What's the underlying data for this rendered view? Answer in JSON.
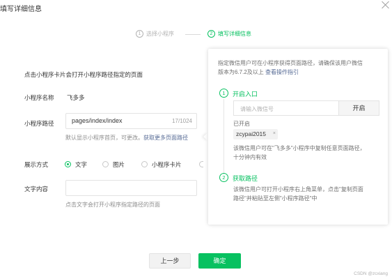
{
  "dialog": {
    "title": "填写详细信息"
  },
  "steps": [
    {
      "num": "1",
      "label": "选择小程序",
      "active": false
    },
    {
      "num": "2",
      "label": "填写详细信息",
      "active": true
    }
  ],
  "form": {
    "intro": "点击小程序卡片会打开小程序路径指定的页面",
    "name_label": "小程序名称",
    "name_value": "飞多多",
    "path_label": "小程序路径",
    "path_value": "pages/index/index",
    "path_counter": "17/1024",
    "path_hint": "默认显示小程序首页，可更改。",
    "path_link": "获取更多页面路径",
    "display_label": "展示方式",
    "display_options": [
      "文字",
      "图片",
      "小程序卡片"
    ],
    "display_selected": "文字",
    "content_label": "文字内容",
    "content_value": "",
    "content_hint": "点击文字会打开小程序指定路径的页面"
  },
  "panel": {
    "intro_line1": "指定微信用户可在小程序获得页面路径，请确保该用户微信",
    "intro_line2": "版本为6.7.2及以上",
    "intro_link": "查看操作指引",
    "step1": {
      "num": "1",
      "title": "开启入口",
      "input_placeholder": "请输入微信号",
      "button": "开启",
      "enabled_label": "已开启",
      "tag": "zcypai2015",
      "tag_close": "×",
      "desc_line1": "该微信用户可在\"飞多多\"小程序中复制任意页面路径，",
      "desc_line2": "十分钟内有效"
    },
    "step2": {
      "num": "2",
      "title": "获取路径",
      "desc_line1": "该微信用户可打开小程序右上角菜单，点击\"复制页面",
      "desc_line2": "路径\"并粘贴至左侧\"小程序路径\"中"
    }
  },
  "footer": {
    "prev_label": "上一步",
    "ok_label": "确定"
  },
  "watermark": "CSDN @zcxiang",
  "colors": {
    "accent": "#07c160",
    "link": "#576b95"
  }
}
